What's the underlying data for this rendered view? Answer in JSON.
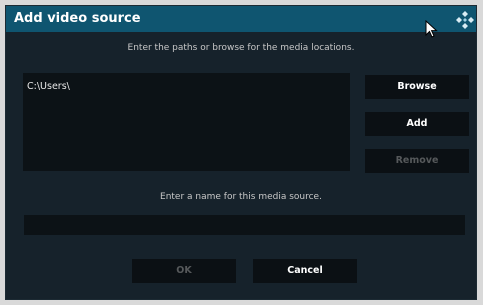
{
  "dialog": {
    "title": "Add video source",
    "paths_instruction": "Enter the paths or browse for the media locations.",
    "paths": [
      "C:\\Users\\"
    ],
    "buttons": {
      "browse": "Browse",
      "add": "Add",
      "remove": "Remove"
    },
    "name_instruction": "Enter a name for this media source.",
    "name_value": "",
    "footer": {
      "ok": "OK",
      "cancel": "Cancel"
    }
  },
  "icons": [
    "kodi-logo-icon",
    "mouse-cursor-icon"
  ],
  "colors": {
    "titlebar": "#0f5570",
    "dialog_bg": "#16222b",
    "field_bg": "#0c1216",
    "button_bg": "#0b1014",
    "disabled_text": "#56595b"
  }
}
